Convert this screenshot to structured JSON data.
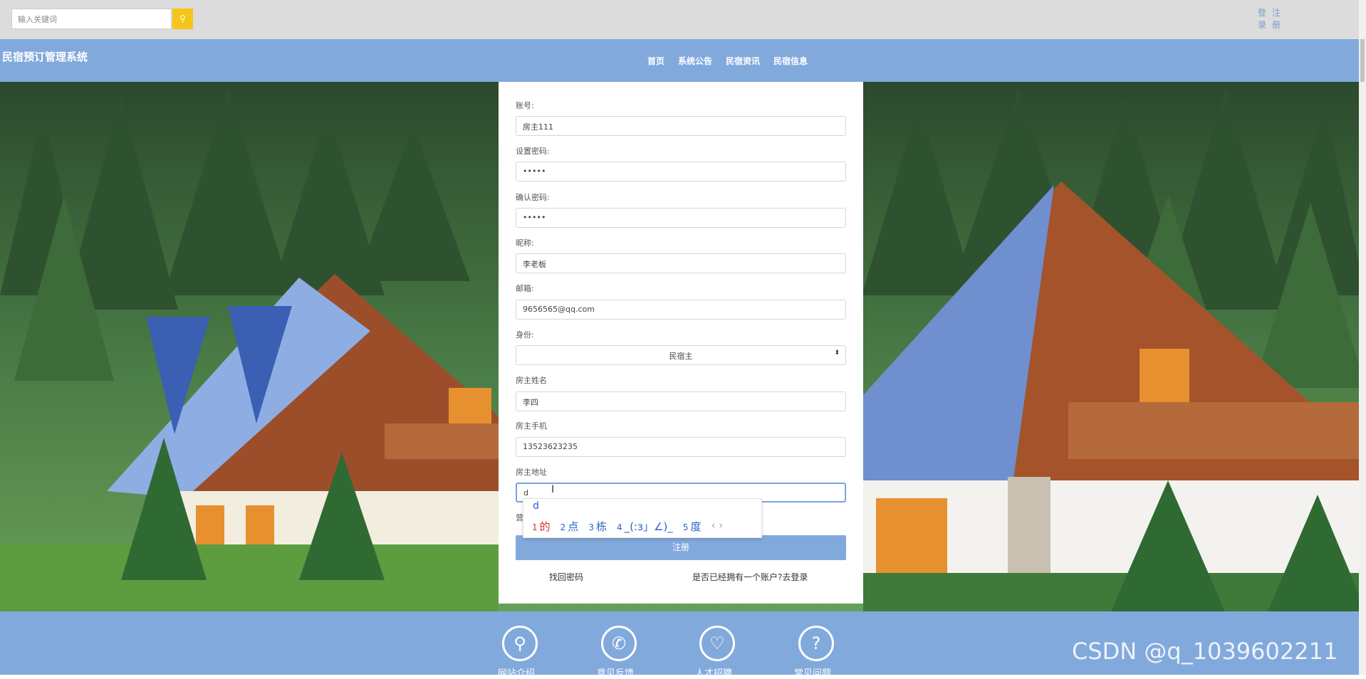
{
  "header": {
    "search_placeholder": "输入关键词",
    "search_icon": "search-icon",
    "login": "登录",
    "register": "注册"
  },
  "navbar": {
    "brand": "民宿预订管理系统",
    "items": [
      "首页",
      "系统公告",
      "民宿资讯",
      "民宿信息"
    ]
  },
  "form": {
    "fields": [
      {
        "label": "账号:",
        "value": "房主111"
      },
      {
        "label": "设置密码:",
        "value": "•••••"
      },
      {
        "label": "确认密码:",
        "value": "•••••"
      },
      {
        "label": "昵称:",
        "value": "李老板"
      },
      {
        "label": "邮箱:",
        "value": "9656565@qq.com"
      },
      {
        "label": "身份:",
        "value": "民宿主"
      },
      {
        "label": "房主姓名",
        "value": "李四"
      },
      {
        "label": "房主手机",
        "value": "13523623235"
      },
      {
        "label": "房主地址",
        "value": "d"
      }
    ],
    "partial_label": "营",
    "submit": "注册",
    "forgot": "找回密码",
    "has_account": "是否已经拥有一个账户?去登录"
  },
  "ime": {
    "typed": "d",
    "candidates": [
      {
        "num": "1",
        "text": "的"
      },
      {
        "num": "2",
        "text": "点"
      },
      {
        "num": "3",
        "text": "栋"
      },
      {
        "num": "4",
        "text": "_(:з」∠)_"
      },
      {
        "num": "5",
        "text": "度"
      }
    ],
    "nav": "‹ ›"
  },
  "footer": {
    "items": [
      {
        "label": "网站介绍",
        "icon": "user-icon",
        "glyph": "⚲"
      },
      {
        "label": "意见反馈",
        "icon": "phone-icon",
        "glyph": "✆"
      },
      {
        "label": "人才招聘",
        "icon": "heart-hand-icon",
        "glyph": "♡"
      },
      {
        "label": "常见问题",
        "icon": "question-icon",
        "glyph": "?"
      }
    ]
  },
  "watermark": "CSDN @q_1039602211"
}
